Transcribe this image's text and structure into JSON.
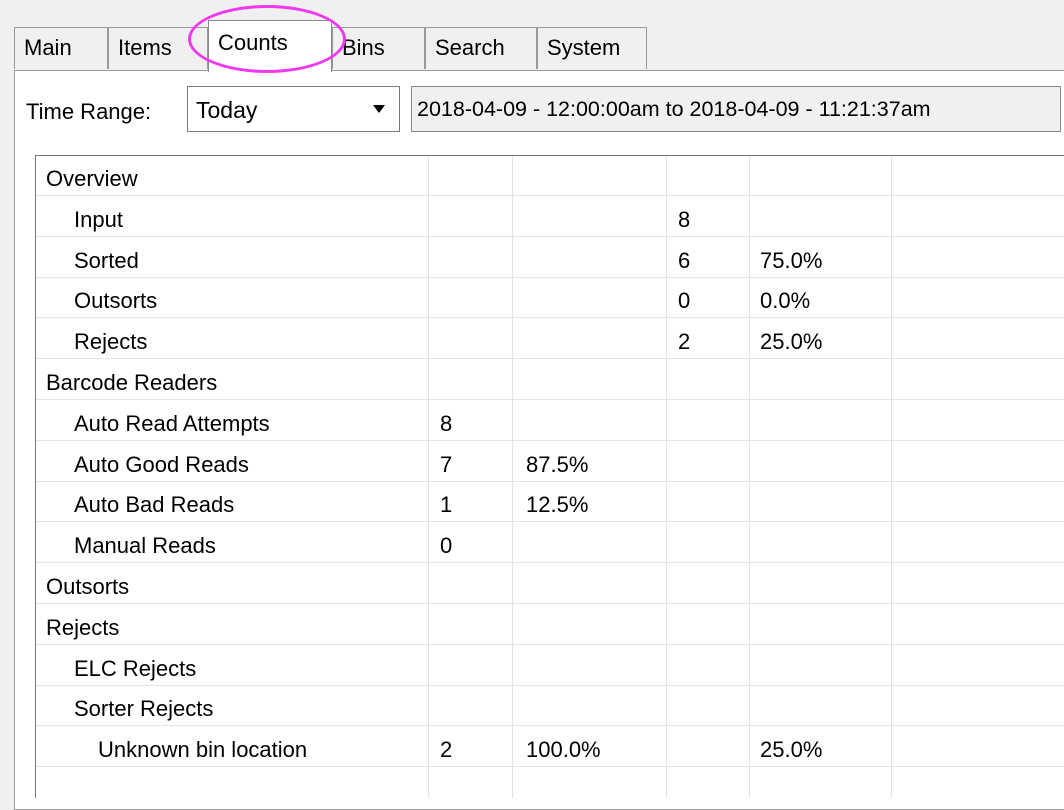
{
  "tabs": [
    {
      "label": "Main"
    },
    {
      "label": "Items"
    },
    {
      "label": "Counts",
      "active": true
    },
    {
      "label": "Bins"
    },
    {
      "label": "Search"
    },
    {
      "label": "System"
    }
  ],
  "time_range": {
    "label": "Time Range:",
    "selected": "Today",
    "range_text": "2018-04-09 - 12:00:00am to 2018-04-09 - 11:21:37am"
  },
  "highlight_color": "#ef38ef",
  "counts": {
    "rows": [
      {
        "label": "Overview",
        "level": 0,
        "c1": "",
        "c2": "",
        "c3": "",
        "c4": ""
      },
      {
        "label": "Input",
        "level": 1,
        "c1": "",
        "c2": "",
        "c3": "8",
        "c4": ""
      },
      {
        "label": "Sorted",
        "level": 1,
        "c1": "",
        "c2": "",
        "c3": "6",
        "c4": "75.0%"
      },
      {
        "label": "Outsorts",
        "level": 1,
        "c1": "",
        "c2": "",
        "c3": "0",
        "c4": "0.0%"
      },
      {
        "label": "Rejects",
        "level": 1,
        "c1": "",
        "c2": "",
        "c3": "2",
        "c4": "25.0%"
      },
      {
        "label": "Barcode Readers",
        "level": 0,
        "c1": "",
        "c2": "",
        "c3": "",
        "c4": ""
      },
      {
        "label": "Auto Read Attempts",
        "level": 1,
        "c1": "8",
        "c2": "",
        "c3": "",
        "c4": ""
      },
      {
        "label": "Auto Good Reads",
        "level": 1,
        "c1": "7",
        "c2": "87.5%",
        "c3": "",
        "c4": ""
      },
      {
        "label": "Auto Bad Reads",
        "level": 1,
        "c1": "1",
        "c2": "12.5%",
        "c3": "",
        "c4": ""
      },
      {
        "label": "Manual Reads",
        "level": 1,
        "c1": "0",
        "c2": "",
        "c3": "",
        "c4": ""
      },
      {
        "label": "Outsorts",
        "level": 0,
        "c1": "",
        "c2": "",
        "c3": "",
        "c4": ""
      },
      {
        "label": "Rejects",
        "level": 0,
        "c1": "",
        "c2": "",
        "c3": "",
        "c4": ""
      },
      {
        "label": "ELC Rejects",
        "level": 1,
        "c1": "",
        "c2": "",
        "c3": "",
        "c4": ""
      },
      {
        "label": "Sorter Rejects",
        "level": 1,
        "c1": "",
        "c2": "",
        "c3": "",
        "c4": ""
      },
      {
        "label": "Unknown bin location",
        "level": 2,
        "c1": "2",
        "c2": "100.0%",
        "c3": "",
        "c4": "25.0%"
      },
      {
        "label": "",
        "level": 0,
        "c1": "",
        "c2": "",
        "c3": "",
        "c4": ""
      }
    ]
  }
}
